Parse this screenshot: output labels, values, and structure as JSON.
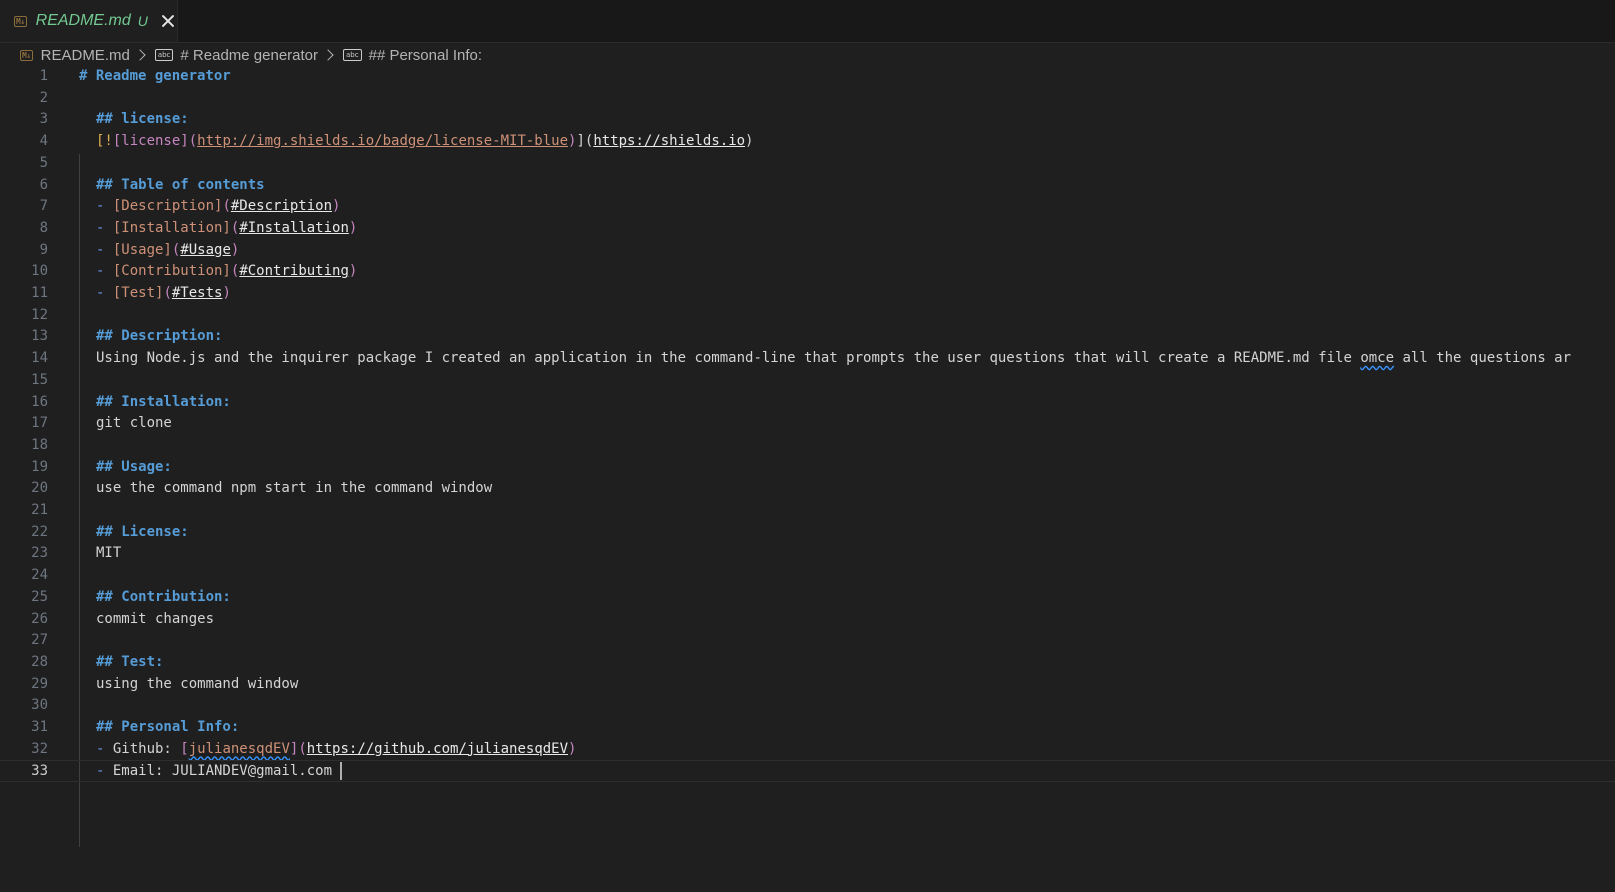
{
  "tab": {
    "file_name": "README.md",
    "status": "U",
    "file_icon": "markdown-icon"
  },
  "breadcrumb": {
    "file": "README.md",
    "section1": "# Readme generator",
    "section2": "## Personal Info:"
  },
  "editor": {
    "current_line": 33,
    "line_numbers": [
      "1",
      "2",
      "3",
      "4",
      "5",
      "6",
      "7",
      "8",
      "9",
      "10",
      "11",
      "12",
      "13",
      "14",
      "15",
      "16",
      "17",
      "18",
      "19",
      "20",
      "21",
      "22",
      "23",
      "24",
      "25",
      "26",
      "27",
      "28",
      "29",
      "30",
      "31",
      "32",
      "33"
    ],
    "lines": {
      "l1": "# Readme generator",
      "l3": "## license:",
      "l4_bang": "[!",
      "l4_alt": "[license]",
      "l4_url": "http://img.shields.io/badge/license-MIT-blue",
      "l4_link": "https://shields.io",
      "l6": "## Table of contents",
      "toc": [
        {
          "text": "[Description]",
          "anchor": "#Description"
        },
        {
          "text": "[Installation]",
          "anchor": "#Installation"
        },
        {
          "text": "[Usage]",
          "anchor": "#Usage"
        },
        {
          "text": "[Contribution]",
          "anchor": "#Contributing"
        },
        {
          "text": "[Test]",
          "anchor": "#Tests"
        }
      ],
      "l13": "## Description:",
      "l14_a": "Using Node.js and the inquirer package I created an application in the command-line that prompts the user questions that will create a README.md file ",
      "l14_typo": "omce",
      "l14_b": " all the questions ar",
      "l16": "## Installation:",
      "l17": "git clone",
      "l19": "## Usage:",
      "l20": "use the command npm start in the command window",
      "l22": "## License:",
      "l23": "MIT",
      "l25": "## Contribution:",
      "l26": "commit changes",
      "l28": "## Test:",
      "l29": "using the command window",
      "l31": "## Personal Info:",
      "l32_label": "Github: ",
      "l32_text": "julianesqdEV",
      "l32_url": "https://github.com/julianesqdEV",
      "l33": "Email: JULIANDEV@gmail.com "
    }
  }
}
